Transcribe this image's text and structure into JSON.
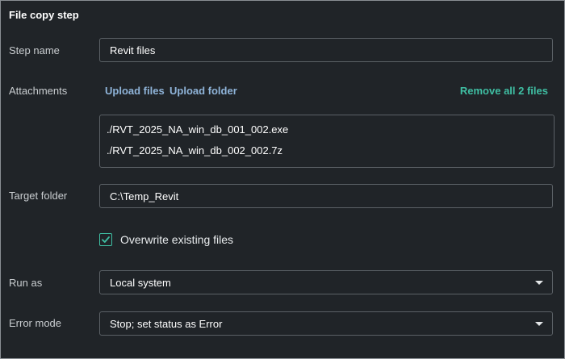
{
  "header": {
    "title": "File copy step"
  },
  "step_name": {
    "label": "Step name",
    "value": "Revit files"
  },
  "attachments": {
    "label": "Attachments",
    "upload_files": "Upload files",
    "upload_folder": "Upload folder",
    "remove_all": "Remove all 2 files",
    "files": [
      "./RVT_2025_NA_win_db_001_002.exe",
      "./RVT_2025_NA_win_db_002_002.7z"
    ]
  },
  "target_folder": {
    "label": "Target folder",
    "value": "C:\\Temp_Revit"
  },
  "overwrite": {
    "label": "Overwrite existing files",
    "checked": true
  },
  "run_as": {
    "label": "Run as",
    "value": "Local system"
  },
  "error_mode": {
    "label": "Error mode",
    "value": "Stop; set status as Error"
  },
  "colors": {
    "accent": "#3fbfa3",
    "link": "#8fb4d9",
    "background": "#202428"
  },
  "icons": {
    "checkbox": "check-icon",
    "dropdown": "chevron-down-icon"
  }
}
